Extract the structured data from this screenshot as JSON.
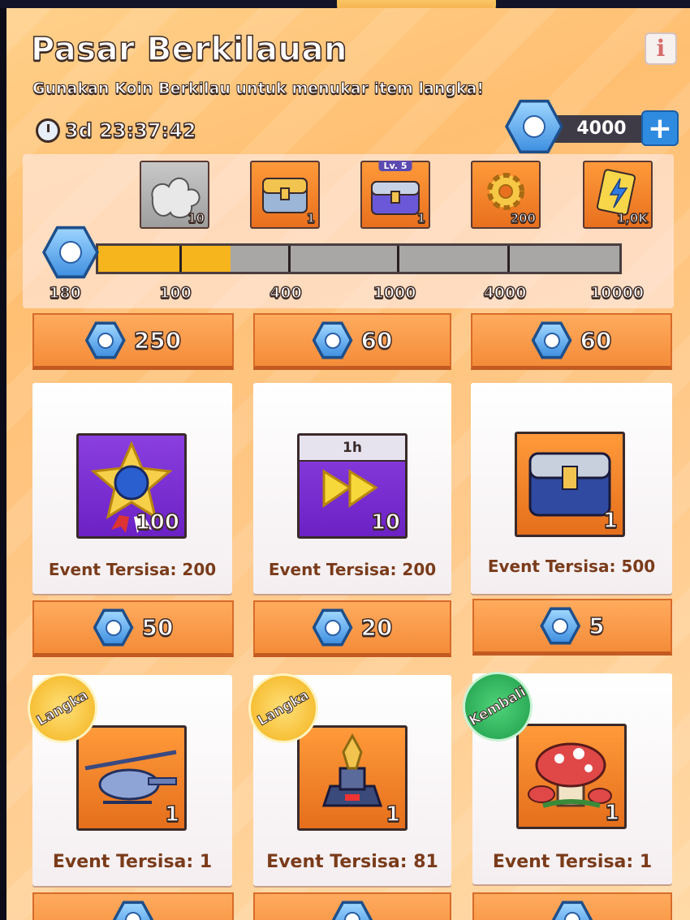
{
  "header": {
    "title": "Pasar Berkilauan",
    "subtitle": "Gunakan Koin Berkilau untuk menukar item langka!",
    "timer": "3d 23:37:42",
    "info_label": "i",
    "balance": "4000",
    "plus_label": "+"
  },
  "milestones": {
    "current": "180",
    "progress_points": 180,
    "items": [
      {
        "icon": "puzzle-piece-icon",
        "qty": "10",
        "threshold": "100",
        "label": ""
      },
      {
        "icon": "treasure-chest-icon",
        "qty": "1",
        "threshold": "400",
        "label": ""
      },
      {
        "icon": "chest-lv5-icon",
        "qty": "1",
        "threshold": "1000",
        "label": "Lv. 5"
      },
      {
        "icon": "gear-icon",
        "qty": "200",
        "threshold": "4000",
        "label": ""
      },
      {
        "icon": "energy-card-icon",
        "qty": "1,0K",
        "threshold": "10000",
        "label": ""
      }
    ]
  },
  "shop": {
    "row1": [
      {
        "price": "250"
      },
      {
        "price": "60"
      },
      {
        "price": "60"
      }
    ],
    "row2": [
      {
        "icon": "star-medal-icon",
        "qty": "100",
        "remaining": "Event Tersisa: 200",
        "price": "50"
      },
      {
        "icon": "speed-up-icon",
        "qty": "10",
        "badge": "1h",
        "remaining": "Event Tersisa: 200",
        "price": "20"
      },
      {
        "icon": "blue-chest-icon",
        "qty": "1",
        "remaining": "Event Tersisa: 500",
        "price": "5"
      }
    ],
    "row3": [
      {
        "icon": "helicopter-icon",
        "qty": "1",
        "tag": "Langka",
        "remaining": "Event Tersisa: 1"
      },
      {
        "icon": "trophy-tower-icon",
        "qty": "1",
        "tag": "Langka",
        "remaining": "Event Tersisa: 81"
      },
      {
        "icon": "mushroom-house-icon",
        "qty": "1",
        "tag": "Kembali",
        "remaining": "Event Tersisa: 1"
      }
    ]
  }
}
